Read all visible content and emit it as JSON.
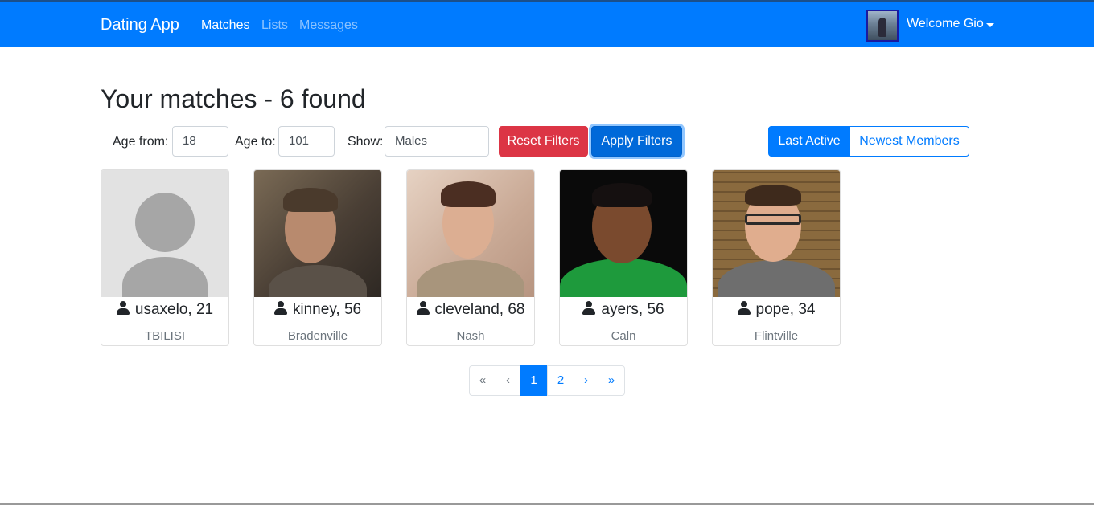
{
  "navbar": {
    "brand": "Dating App",
    "links": [
      "Matches",
      "Lists",
      "Messages"
    ],
    "welcome": "Welcome Gio",
    "bg_color": "#007bff"
  },
  "page_title": "Your matches - 6 found",
  "filters": {
    "age_from_label": "Age from:",
    "age_from_value": "18",
    "age_to_label": "Age to:",
    "age_to_value": "101",
    "show_label": "Show:",
    "show_value": "Males",
    "reset_label": "Reset Filters",
    "apply_label": "Apply Filters"
  },
  "sort": {
    "options": [
      "Last Active",
      "Newest Members"
    ],
    "selected": "Last Active"
  },
  "members": [
    {
      "name": "usaxelo, 21",
      "city": "TBILISI",
      "photo": "placeholder"
    },
    {
      "name": "kinney, 56",
      "city": "Bradenville",
      "photo": "man-dark-background"
    },
    {
      "name": "cleveland, 68",
      "city": "Nash",
      "photo": "man-beige-jacket"
    },
    {
      "name": "ayers, 56",
      "city": "Caln",
      "photo": "man-green-shirt"
    },
    {
      "name": "pope, 34",
      "city": "Flintville",
      "photo": "man-glasses-brick-wall"
    }
  ],
  "pagination": {
    "first": "«",
    "prev": "‹",
    "pages": [
      "1",
      "2"
    ],
    "current": "1",
    "next": "›",
    "last": "»"
  },
  "colors": {
    "primary": "#007bff",
    "danger": "#dc3545",
    "muted": "#6c757d"
  },
  "icons": [
    "user-icon",
    "caret-down-icon"
  ]
}
